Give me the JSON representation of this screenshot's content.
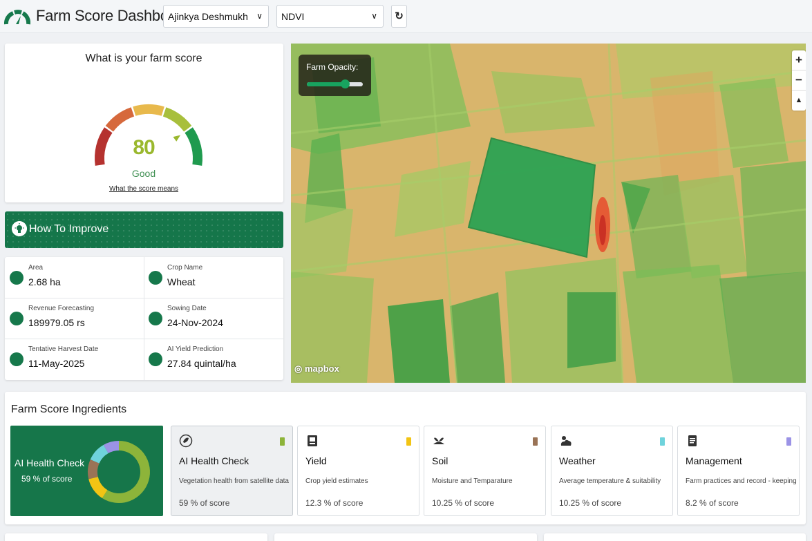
{
  "header": {
    "title": "Farm Score Dashboard",
    "farmer_select": "Ajinkya Deshmukh",
    "layer_select": "NDVI",
    "refresh_icon": "refresh-icon",
    "dropdown_icon": "chevron-down-icon"
  },
  "score": {
    "title": "What is your farm score",
    "value": "80",
    "value_numeric": 80,
    "label": "Good",
    "link": "What the score means",
    "colors": [
      "#b5322f",
      "#d6693c",
      "#e8b94c",
      "#a8bf3c",
      "#1f9a4e"
    ]
  },
  "improve": {
    "label": "How To Improve",
    "icon": "lightbulb-icon"
  },
  "farm_info": [
    {
      "label": "Area",
      "value": "2.68 ha",
      "icon": "area-icon"
    },
    {
      "label": "Crop Name",
      "value": "Wheat",
      "icon": "crop-icon"
    },
    {
      "label": "Revenue Forecasting",
      "value": "189979.05 rs",
      "icon": "revenue-icon"
    },
    {
      "label": "Sowing Date",
      "value": "24-Nov-2024",
      "icon": "sowing-icon"
    },
    {
      "label": "Tentative Harvest Date",
      "value": "11-May-2025",
      "icon": "harvest-icon"
    },
    {
      "label": "AI Yield Prediction",
      "value": "27.84 quintal/ha",
      "icon": "yield-prediction-icon"
    }
  ],
  "map": {
    "opacity_label": "Farm Opacity:",
    "opacity_value": 0.68,
    "zoom_in": "+",
    "zoom_out": "−",
    "compass": "▲",
    "attribution": "mapbox"
  },
  "ingredients": {
    "title": "Farm Score Ingredients",
    "highlight": {
      "title": "AI Health Check",
      "pct": "59 % of score",
      "donut": [
        {
          "name": "AI Health Check",
          "value": 59,
          "color": "#8db43a"
        },
        {
          "name": "Yield",
          "value": 12.3,
          "color": "#f2c414"
        },
        {
          "name": "Soil",
          "value": 10.25,
          "color": "#9a7356"
        },
        {
          "name": "Weather",
          "value": 10.25,
          "color": "#6fd3dc"
        },
        {
          "name": "Management",
          "value": 8.2,
          "color": "#9b93e6"
        }
      ]
    },
    "items": [
      {
        "name": "AI Health Check",
        "desc": "Vegetation health from satellite data",
        "pct": "59 % of score",
        "color": "#8db43a",
        "icon": "leaf-check-icon"
      },
      {
        "name": "Yield",
        "desc": "Crop yield estimates",
        "pct": "12.3 % of score",
        "color": "#f2c414",
        "icon": "yield-icon"
      },
      {
        "name": "Soil",
        "desc": "Moisture and Temparature",
        "pct": "10.25 % of score",
        "color": "#9a7356",
        "icon": "soil-icon"
      },
      {
        "name": "Weather",
        "desc": "Average temperature & suitability",
        "pct": "10.25 % of score",
        "color": "#6fd3dc",
        "icon": "weather-icon"
      },
      {
        "name": "Management",
        "desc": "Farm practices and record - keeping",
        "pct": "8.2 % of score",
        "color": "#9b93e6",
        "icon": "management-icon"
      }
    ]
  }
}
